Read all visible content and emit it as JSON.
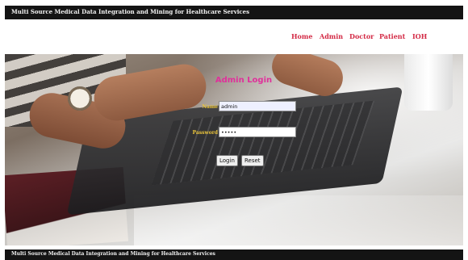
{
  "header": {
    "title": "Multi Source Medical Data Integration and Mining for Healthcare Services"
  },
  "nav": {
    "items": [
      {
        "label": "Home"
      },
      {
        "label": "Admin"
      },
      {
        "label": "Doctor"
      },
      {
        "label": "Patient"
      },
      {
        "label": "IOH"
      }
    ],
    "color": "#d32a45"
  },
  "login": {
    "title": "Admin Login",
    "title_color": "#e0309b",
    "name_label": "Name",
    "name_value": "admin",
    "password_label": "Password",
    "password_value": "•••••",
    "login_button": "Login",
    "reset_button": "Reset",
    "label_color": "#e8c33b"
  },
  "footer": {
    "text": "Multi Source Medical Data Integration and Mining for Healthcare Services"
  }
}
